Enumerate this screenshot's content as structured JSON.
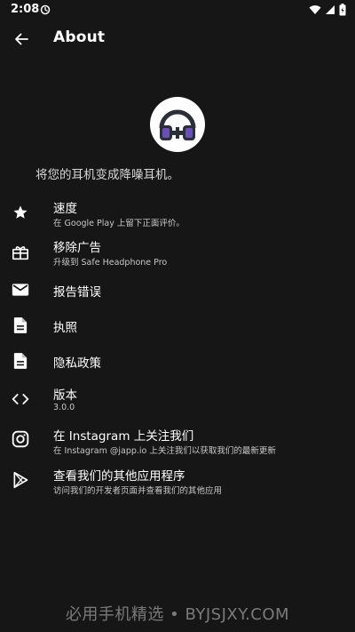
{
  "status_bar": {
    "time": "2:08"
  },
  "app_bar": {
    "title": "About"
  },
  "tagline": "将您的耳机变成降噪耳机。",
  "items": [
    {
      "title": "速度",
      "subtitle": "在 Google Play 上留下正面评价。",
      "icon": "star-icon"
    },
    {
      "title": "移除广告",
      "subtitle": "升级到 Safe Headphone Pro",
      "icon": "gift-icon"
    },
    {
      "title": "报告错误",
      "subtitle": "",
      "icon": "mail-icon"
    },
    {
      "title": "执照",
      "subtitle": "",
      "icon": "document-icon"
    },
    {
      "title": "隐私政策",
      "subtitle": "",
      "icon": "document-icon"
    },
    {
      "title": "版本",
      "subtitle": "3.0.0",
      "icon": "code-icon"
    },
    {
      "title": "在 Instagram 上关注我们",
      "subtitle": "在 Instagram @japp.io 上关注我们以获取我们的最新更新",
      "icon": "instagram-icon"
    },
    {
      "title": "查看我们的其他应用程序",
      "subtitle": "访问我们的开发者页面并查看我们的其他应用",
      "icon": "play-store-icon"
    }
  ],
  "watermark": "必用手机精选 • BYJSJXY.COM",
  "colors": {
    "background": "#161616",
    "accent": "#6a4fb5"
  }
}
